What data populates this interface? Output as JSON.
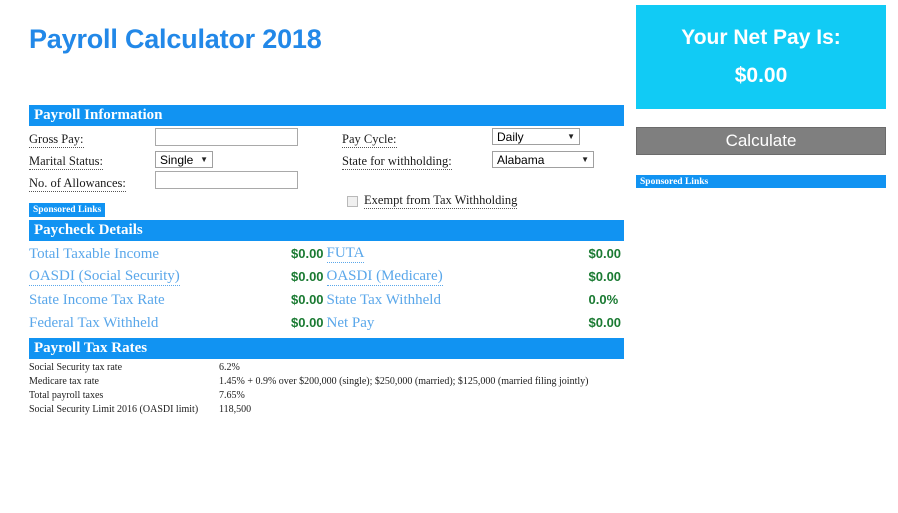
{
  "page": {
    "title": "Payroll Calculator 2018"
  },
  "colors": {
    "title_blue": "#2288e8",
    "section_bar_blue": "#1193f2",
    "netpay_cyan": "#11cbf5",
    "value_green": "#1a7a32",
    "label_blue": "#5aa7ea",
    "button_gray": "#7f7f7f"
  },
  "payroll_information": {
    "heading": "Payroll Information",
    "gross_pay": {
      "label": "Gross Pay:",
      "value": "",
      "placeholder": ""
    },
    "marital_status": {
      "label": "Marital Status:",
      "selected": "Single"
    },
    "allowances": {
      "label": "No. of Allowances:",
      "value": "",
      "placeholder": ""
    },
    "pay_cycle": {
      "label": "Pay Cycle:",
      "selected": "Daily"
    },
    "state_withholding": {
      "label": "State for withholding:",
      "selected": "Alabama"
    },
    "exempt": {
      "label": "Exempt from Tax Withholding",
      "checked": false
    },
    "sponsored_chip": "Sponsored Links"
  },
  "paycheck_details": {
    "heading": "Paycheck Details",
    "rows": [
      {
        "left_label": "Total Taxable Income",
        "left_dotted": false,
        "left_value": "$0.00",
        "right_label": "FUTA",
        "right_dotted": true,
        "right_value": "$0.00"
      },
      {
        "left_label": "OASDI (Social Security)",
        "left_dotted": true,
        "left_value": "$0.00",
        "right_label": "OASDI (Medicare)",
        "right_dotted": true,
        "right_value": "$0.00"
      },
      {
        "left_label": "State Income Tax Rate",
        "left_dotted": false,
        "left_value": "$0.00",
        "right_label": "State Tax Withheld",
        "right_dotted": false,
        "right_value": "0.0%"
      },
      {
        "left_label": "Federal Tax Withheld",
        "left_dotted": false,
        "left_value": "$0.00",
        "right_label": "Net Pay",
        "right_dotted": false,
        "right_value": "$0.00"
      }
    ]
  },
  "payroll_tax_rates": {
    "heading": "Payroll Tax Rates",
    "rows": [
      {
        "name": "Social Security tax rate",
        "value": "6.2%"
      },
      {
        "name": "Medicare tax rate",
        "value": "1.45% + 0.9% over $200,000 (single); $250,000 (married); $125,000 (married filing jointly)"
      },
      {
        "name": "Total payroll taxes",
        "value": "7.65%"
      },
      {
        "name": "Social Security Limit 2016 (OASDI limit)",
        "value": "118,500"
      }
    ]
  },
  "result_panel": {
    "net_pay_title": "Your Net Pay Is:",
    "net_pay_amount": "$0.00",
    "calculate_label": "Calculate",
    "sponsored_label": "Sponsored Links"
  },
  "icons": {
    "dropdown_arrow": "▼"
  }
}
